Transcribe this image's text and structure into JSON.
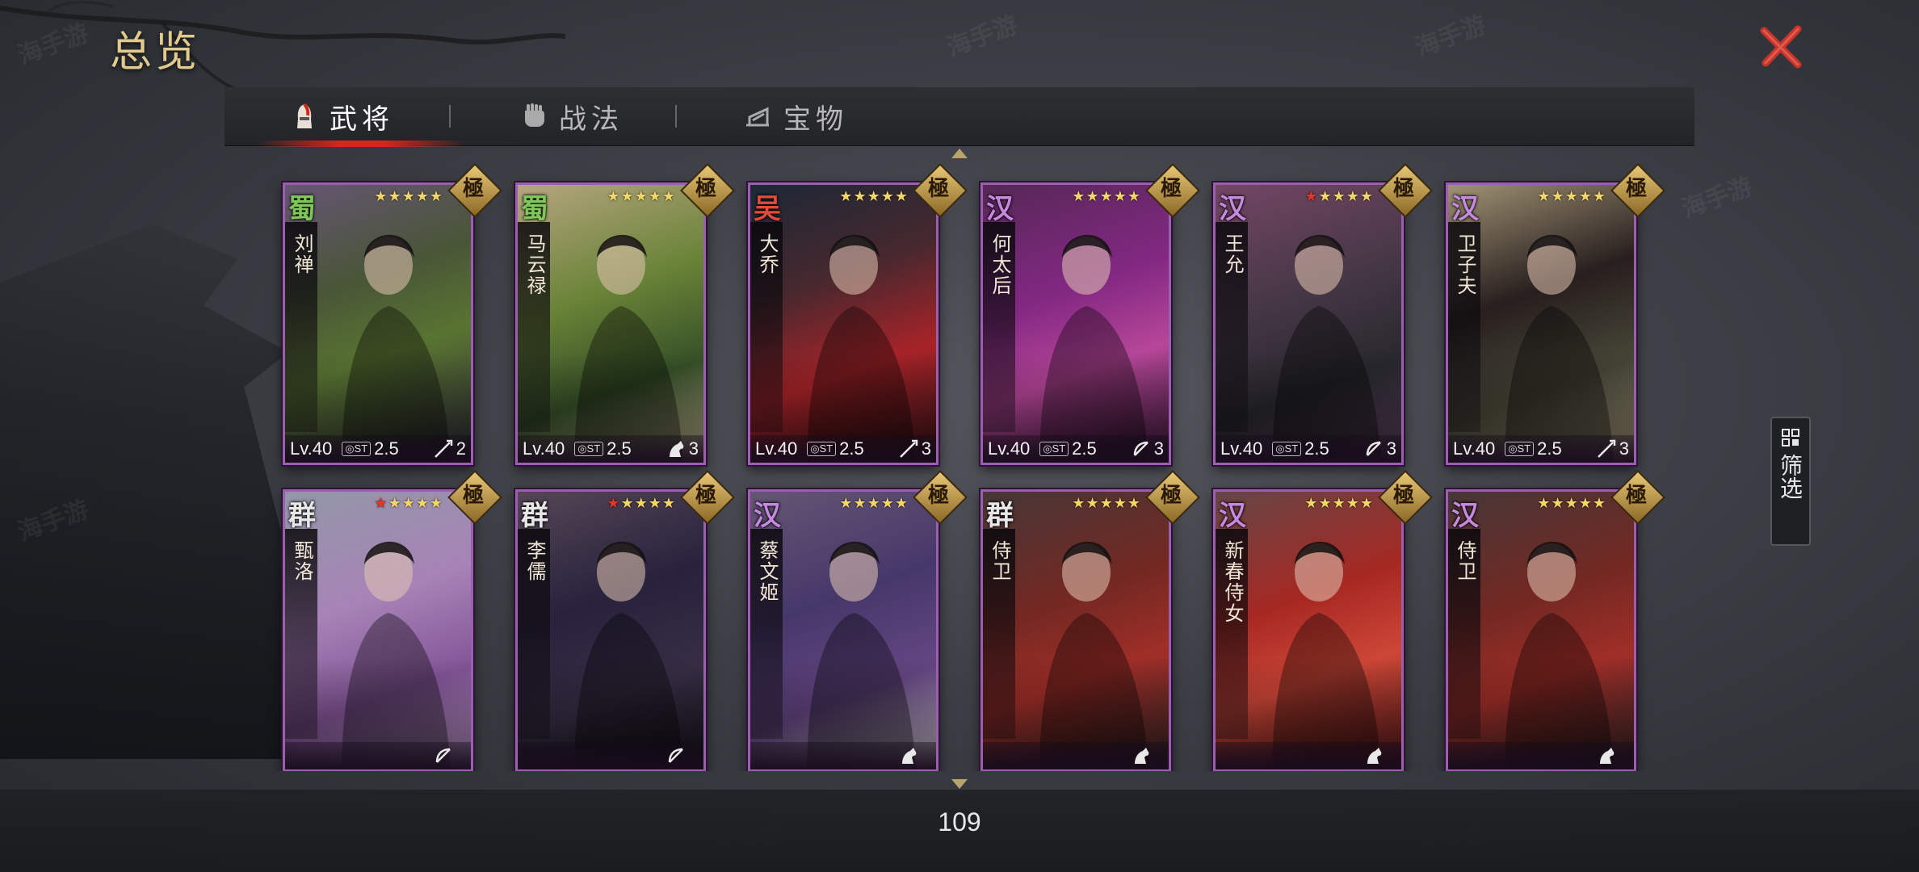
{
  "header": {
    "title": "总览"
  },
  "tabs": [
    {
      "label": "武将",
      "icon": "helmet-icon",
      "active": true
    },
    {
      "label": "战法",
      "icon": "fist-icon",
      "active": false
    },
    {
      "label": "宝物",
      "icon": "treasure-icon",
      "active": false
    }
  ],
  "colors": {
    "accent_red": "#d6281a",
    "gold": "#e2c98e",
    "card_border": "#9b5fb0"
  },
  "filter": {
    "label": "筛选"
  },
  "footer": {
    "count": "109"
  },
  "cards": [
    {
      "faction": "蜀",
      "faction_color": "#7ec85a",
      "name": "刘禅",
      "stars": 5,
      "red_stars": 0,
      "rank": "極",
      "level": "Lv.40",
      "cost": "2.5",
      "troop_icon": "spear-icon",
      "troop": "2",
      "art": "green-king"
    },
    {
      "faction": "蜀",
      "faction_color": "#7ec85a",
      "name": "马云禄",
      "stars": 5,
      "red_stars": 0,
      "rank": "極",
      "level": "Lv.40",
      "cost": "2.5",
      "troop_icon": "horse-icon",
      "troop": "3",
      "art": "green-warrior"
    },
    {
      "faction": "吴",
      "faction_color": "#e04b3b",
      "name": "大乔",
      "stars": 5,
      "red_stars": 0,
      "rank": "極",
      "level": "Lv.40",
      "cost": "2.5",
      "troop_icon": "spear-icon",
      "troop": "3",
      "art": "red-lady"
    },
    {
      "faction": "汉",
      "faction_color": "#c58ae0",
      "name": "何太后",
      "stars": 5,
      "red_stars": 0,
      "rank": "極",
      "level": "Lv.40",
      "cost": "2.5",
      "troop_icon": "bow-icon",
      "troop": "3",
      "art": "magenta-lady"
    },
    {
      "faction": "汉",
      "faction_color": "#c58ae0",
      "name": "王允",
      "stars": 5,
      "red_stars": 1,
      "rank": "極",
      "level": "Lv.40",
      "cost": "2.5",
      "troop_icon": "bow-icon",
      "troop": "3",
      "art": "old-minister"
    },
    {
      "faction": "汉",
      "faction_color": "#c58ae0",
      "name": "卫子夫",
      "stars": 5,
      "red_stars": 0,
      "rank": "極",
      "level": "Lv.40",
      "cost": "2.5",
      "troop_icon": "spear-icon",
      "troop": "3",
      "art": "black-hair-lady"
    },
    {
      "faction": "群",
      "faction_color": "#e8e8e8",
      "name": "甄洛",
      "stars": 5,
      "red_stars": 1,
      "rank": "極",
      "level": "",
      "cost": "",
      "troop_icon": "bow-icon",
      "troop": "",
      "art": "purple-lady"
    },
    {
      "faction": "群",
      "faction_color": "#e8e8e8",
      "name": "李儒",
      "stars": 5,
      "red_stars": 1,
      "rank": "極",
      "level": "",
      "cost": "",
      "troop_icon": "bow-icon",
      "troop": "",
      "art": "dark-strategist"
    },
    {
      "faction": "汉",
      "faction_color": "#c58ae0",
      "name": "蔡文姬",
      "stars": 5,
      "red_stars": 0,
      "rank": "極",
      "level": "",
      "cost": "",
      "troop_icon": "horse-icon",
      "troop": "",
      "art": "pipa-lady"
    },
    {
      "faction": "群",
      "faction_color": "#e8e8e8",
      "name": "侍卫",
      "stars": 5,
      "red_stars": 0,
      "rank": "極",
      "level": "",
      "cost": "",
      "troop_icon": "horse-icon",
      "troop": "",
      "art": "red-guard"
    },
    {
      "faction": "汉",
      "faction_color": "#c58ae0",
      "name": "新春侍女",
      "stars": 5,
      "red_stars": 0,
      "rank": "極",
      "level": "",
      "cost": "",
      "troop_icon": "horse-icon",
      "troop": "",
      "art": "red-dancer"
    },
    {
      "faction": "汉",
      "faction_color": "#c58ae0",
      "name": "侍卫",
      "stars": 5,
      "red_stars": 0,
      "rank": "極",
      "level": "",
      "cost": "",
      "troop_icon": "horse-icon",
      "troop": "",
      "art": "red-guard"
    }
  ]
}
